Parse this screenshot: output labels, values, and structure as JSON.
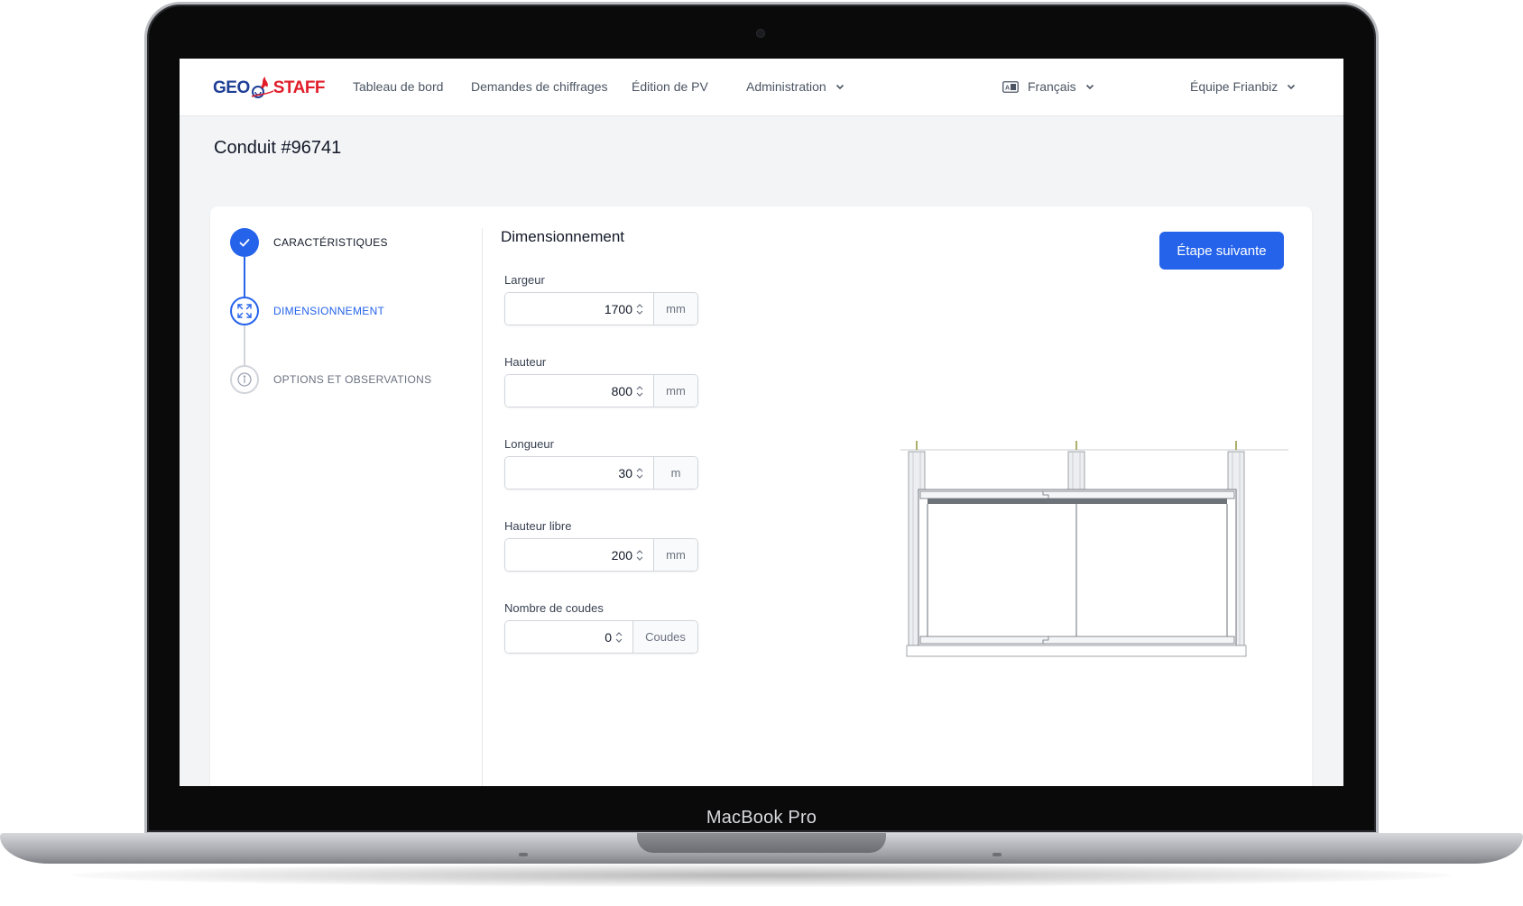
{
  "device": {
    "label": "MacBook Pro"
  },
  "nav": {
    "logo_left": "GEO",
    "logo_right": "STAFF",
    "links": [
      "Tableau de bord",
      "Demandes de chiffrages",
      "Édition de PV"
    ],
    "admin": "Administration",
    "language": "Français",
    "team": "Équipe Frianbiz"
  },
  "page": {
    "title": "Conduit #96741"
  },
  "steps": [
    {
      "label": "CARACTÉRISTIQUES",
      "status": "complete",
      "icon": "check-icon"
    },
    {
      "label": "DIMENSIONNEMENT",
      "status": "current",
      "icon": "expand-icon"
    },
    {
      "label": "OPTIONS ET OBSERVATIONS",
      "status": "upcoming",
      "icon": "info-icon"
    }
  ],
  "form": {
    "title": "Dimensionnement",
    "next_button": "Étape suivante",
    "fields": [
      {
        "label": "Largeur",
        "value": "1700",
        "unit": "mm"
      },
      {
        "label": "Hauteur",
        "value": "800",
        "unit": "mm"
      },
      {
        "label": "Longueur",
        "value": "30",
        "unit": "m"
      },
      {
        "label": "Hauteur libre",
        "value": "200",
        "unit": "mm"
      },
      {
        "label": "Nombre de coudes",
        "value": "0",
        "unit": "Coudes"
      }
    ]
  },
  "colors": {
    "primary": "#2563eb",
    "logo_blue": "#1f3f97",
    "logo_red": "#e11d2a",
    "page_bg": "#f3f4f6"
  }
}
